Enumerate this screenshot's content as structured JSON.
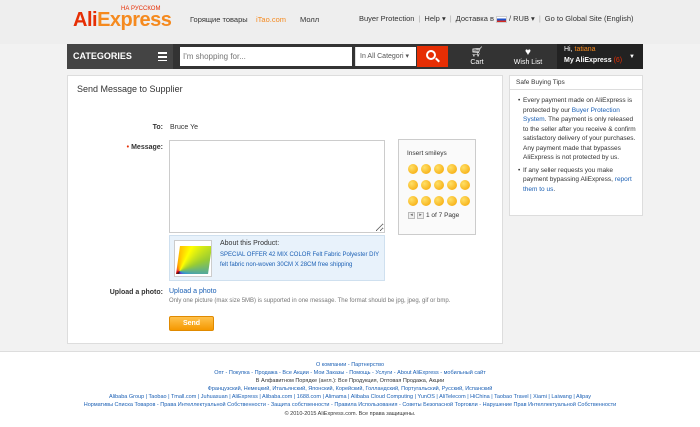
{
  "header": {
    "logo_ru": "НА РУССКОМ",
    "logo_ali": "Ali",
    "logo_express": "Express",
    "links": [
      "Горящие товары",
      "iTao.com",
      "Молл"
    ],
    "buyer_protection": "Buyer Protection",
    "help": "Help",
    "delivery": "Доставка в",
    "currency": "/ RUB",
    "global_site": "Go to Global Site (English)"
  },
  "nav": {
    "categories": "CATEGORIES",
    "search_placeholder": "I'm shopping for...",
    "search_category": "In All Categori",
    "cart": "Cart",
    "wishlist": "Wish List",
    "hi": "Hi,",
    "user": "tatiana",
    "my_aliexpress": "My AliExpress",
    "count": "(6)"
  },
  "form": {
    "title": "Send Message to Supplier",
    "to_label": "To:",
    "to_value": "Bruce Ye",
    "message_label": "Message:",
    "smileys_title": "Insert smileys",
    "smileys_page": "1 of 7 Page",
    "product_title": "About this Product:",
    "product_link": "SPECIAL OFFER 42 MIX COLOR Felt Fabric Polyester DIY felt fabric non-woven 30CM X 28CM free shipping",
    "upload_label": "Upload a photo:",
    "upload_link": "Upload a photo",
    "upload_note": "Only one picture (max size 5MB) is supported in one message. The format should be jpg, jpeg, gif or bmp.",
    "send": "Send"
  },
  "tips": {
    "title": "Safe Buying Tips",
    "t1_a": "Every payment made on AliExpress is protected by our ",
    "t1_link": "Buyer Protection System",
    "t1_b": ". The payment is only released to the seller after you receive & confirm satisfactory delivery of your purchases. Any payment made that bypasses AliExpress is not protected by us.",
    "t2_a": "If any seller requests you make payment bypassing AliExpress, ",
    "t2_link": "report them to us",
    "t2_b": "."
  },
  "footer": {
    "row1": "О компании - Партнерство",
    "row2": "Опт - Покупка - Продажа - Все Акции - Мои Заказы - Помощь - Услуги - About AliExpress - мобильный сайт",
    "row3": "В Алфавитном Порядке (англ.): Все Продукция, Оптовая Продажа, Акции",
    "row4": "Французский, Немецкий, Итальянский, Японский, Корейский, Голландский, Португальский, Русский, Испанский",
    "row5": "Alibaba Group | Taobao | Tmall.com | Juhuasuan | AliExpress | Alibaba.com | 1688.com | Alimama | Alibaba Cloud Computing | YunOS | AliTelecom | HiChina | Taobao Travel | Xiami | Laiwang | Alipay",
    "row6": "Нормативы Списка Товаров - Права Интеллектуальной Собственности - Защита собственности - Правила Использования - Советы Безопасной Торговли - Нарушение Прав Интеллектуальной Собственности",
    "row7": "© 2010-2015 AliExpress.com. Все права защищены."
  }
}
